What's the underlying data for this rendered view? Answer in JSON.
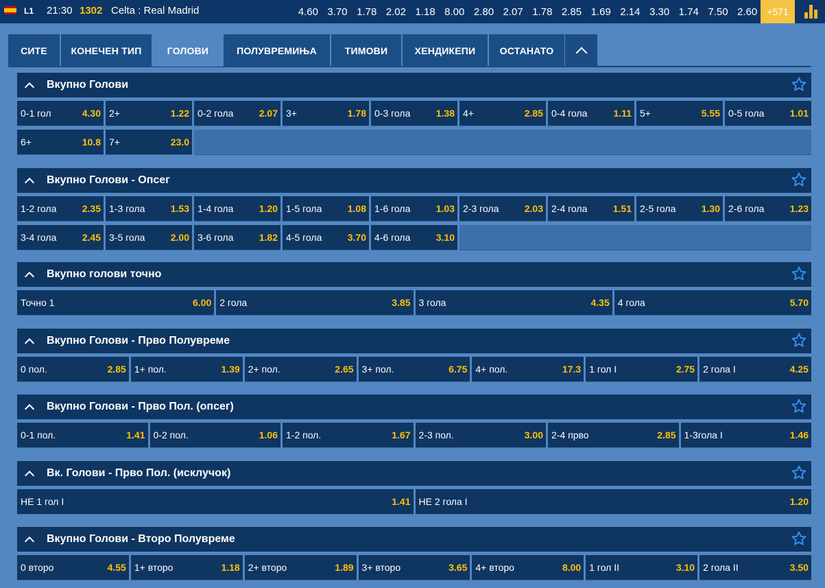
{
  "match": {
    "league": "L1",
    "time": "21:30",
    "code": "1302",
    "teams": "Celta : Real Madrid",
    "odds": [
      "4.60",
      "3.70",
      "1.78",
      "2.02",
      "1.18",
      "8.00",
      "2.80",
      "2.07",
      "1.78",
      "2.85",
      "1.69",
      "2.14",
      "3.30",
      "1.74",
      "7.50",
      "2.60"
    ],
    "more": "+571"
  },
  "tabs": [
    "СИТЕ",
    "КОНЕЧЕН ТИП",
    "ГОЛОВИ",
    "ПОЛУВРЕМИЊА",
    "ТИМОВИ",
    "ХЕНДИКЕПИ",
    "ОСТАНАТО"
  ],
  "active_tab": "ГОЛОВИ",
  "colors": {
    "accent": "#ffc107",
    "header": "#0f3561",
    "background": "#5287c1",
    "more_button": "#f6c444"
  },
  "markets": [
    {
      "title": "Вкупно Голови",
      "rows": [
        [
          [
            "0-1 гол",
            "4.30"
          ],
          [
            "2+",
            "1.22"
          ],
          [
            "0-2 гола",
            "2.07"
          ],
          [
            "3+",
            "1.78"
          ],
          [
            "0-3 гола",
            "1.38"
          ],
          [
            "4+",
            "2.85"
          ],
          [
            "0-4 гола",
            "1.11"
          ],
          [
            "5+",
            "5.55"
          ],
          [
            "0-5 гола",
            "1.01"
          ]
        ],
        [
          [
            "6+",
            "10.8"
          ],
          [
            "7+",
            "23.0"
          ]
        ]
      ]
    },
    {
      "title": "Вкупно Голови - Опсег",
      "rows": [
        [
          [
            "1-2 гола",
            "2.35"
          ],
          [
            "1-3 гола",
            "1.53"
          ],
          [
            "1-4 гола",
            "1.20"
          ],
          [
            "1-5 гола",
            "1.08"
          ],
          [
            "1-6 гола",
            "1.03"
          ],
          [
            "2-3 гола",
            "2.03"
          ],
          [
            "2-4 гола",
            "1.51"
          ],
          [
            "2-5 гола",
            "1.30"
          ],
          [
            "2-6 гола",
            "1.23"
          ]
        ],
        [
          [
            "3-4 гола",
            "2.45"
          ],
          [
            "3-5 гола",
            "2.00"
          ],
          [
            "3-6 гола",
            "1.82"
          ],
          [
            "4-5 гола",
            "3.70"
          ],
          [
            "4-6 гола",
            "3.10"
          ]
        ]
      ]
    },
    {
      "title": "Вкупно голови точно",
      "rows": [
        [
          [
            "Точно 1",
            "6.00"
          ],
          [
            "2 гола",
            "3.85"
          ],
          [
            "3 гола",
            "4.35"
          ],
          [
            "4 гола",
            "5.70"
          ]
        ]
      ]
    },
    {
      "title": "Вкупно Голови - Прво Полувреме",
      "rows": [
        [
          [
            "0 пол.",
            "2.85"
          ],
          [
            "1+ пол.",
            "1.39"
          ],
          [
            "2+ пол.",
            "2.65"
          ],
          [
            "3+ пол.",
            "6.75"
          ],
          [
            "4+ пол.",
            "17.3"
          ],
          [
            "1 гол I",
            "2.75"
          ],
          [
            "2 гола I",
            "4.25"
          ]
        ]
      ]
    },
    {
      "title": "Вкупно Голови - Прво Пол. (опсег)",
      "rows": [
        [
          [
            "0-1 пол.",
            "1.41"
          ],
          [
            "0-2 пол.",
            "1.06"
          ],
          [
            "1-2 пол.",
            "1.67"
          ],
          [
            "2-3 пол.",
            "3.00"
          ],
          [
            "2-4 прво",
            "2.85"
          ],
          [
            "1-3гола I",
            "1.46"
          ]
        ]
      ]
    },
    {
      "title": "Вк. Голови - Прво Пол. (исклучок)",
      "rows": [
        [
          [
            "НЕ 1 гол I",
            "1.41"
          ],
          [
            "НЕ 2 гола I",
            "1.20"
          ]
        ]
      ]
    },
    {
      "title": "Вкупно Голови - Второ Полувреме",
      "rows": [
        [
          [
            "0 второ",
            "4.55"
          ],
          [
            "1+ второ",
            "1.18"
          ],
          [
            "2+ второ",
            "1.89"
          ],
          [
            "3+ второ",
            "3.65"
          ],
          [
            "4+ второ",
            "8.00"
          ],
          [
            "1 гол II",
            "3.10"
          ],
          [
            "2 гола II",
            "3.50"
          ]
        ]
      ]
    }
  ]
}
